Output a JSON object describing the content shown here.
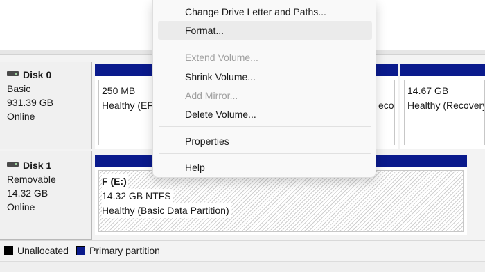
{
  "disks": [
    {
      "name": "Disk 0",
      "type": "Basic",
      "size": "931.39 GB",
      "status": "Online",
      "partitions": [
        {
          "size": "250 MB",
          "status": "Healthy (EFI System Partition)"
        },
        {
          "status_fragment": "ecov"
        },
        {
          "size": "14.67 GB",
          "status": "Healthy (Recovery Partition)"
        }
      ]
    },
    {
      "name": "Disk 1",
      "type": "Removable",
      "size": "14.32 GB",
      "status": "Online",
      "partitions": [
        {
          "title": "F  (E:)",
          "size": "14.32 GB NTFS",
          "status": "Healthy (Basic Data Partition)"
        }
      ]
    }
  ],
  "legend": [
    {
      "label": "Unallocated",
      "color": "#000000"
    },
    {
      "label": "Primary partition",
      "color": "#0a1a8c"
    }
  ],
  "context_menu": {
    "items": [
      {
        "label": "Change Drive Letter and Paths...",
        "enabled": true
      },
      {
        "label": "Format...",
        "enabled": true,
        "highlighted": true
      },
      {
        "label": "Extend Volume...",
        "enabled": false
      },
      {
        "label": "Shrink Volume...",
        "enabled": true
      },
      {
        "label": "Add Mirror...",
        "enabled": false
      },
      {
        "label": "Delete Volume...",
        "enabled": true
      },
      {
        "label": "Properties",
        "enabled": true
      },
      {
        "label": "Help",
        "enabled": true
      }
    ]
  },
  "colors": {
    "primary_partition": "#0a1a8c",
    "menu_bg": "#f9f9f9",
    "menu_highlight": "#ebebeb",
    "disabled_text": "#a0a0a0"
  }
}
